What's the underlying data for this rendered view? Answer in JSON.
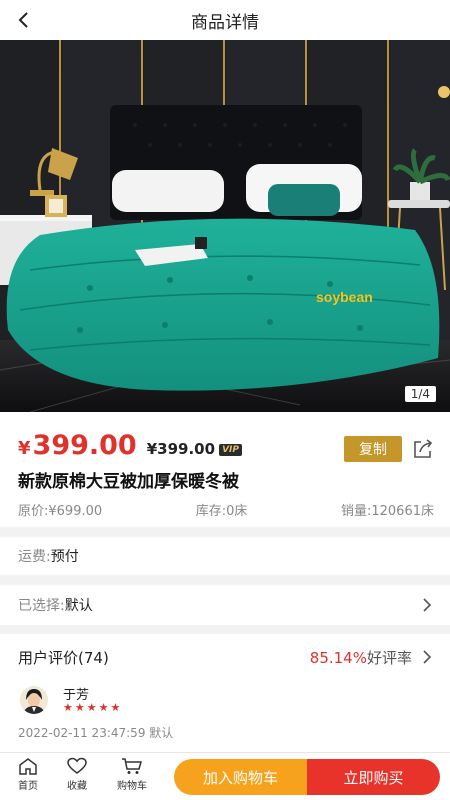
{
  "header": {
    "title": "商品详情"
  },
  "gallery": {
    "page_indicator": "1/4"
  },
  "price": {
    "currency": "¥",
    "main": "399.00",
    "vip_price": "¥399.00",
    "vip_badge": "VIP",
    "copy_label": "复制"
  },
  "product": {
    "name": "新款原棉大豆被加厚保暖冬被",
    "original_price": "原价:¥699.00",
    "stock": "库存:0床",
    "sales": "销量:120661床"
  },
  "shipping": {
    "label": "运费:",
    "value": "预付"
  },
  "selection": {
    "label": "已选择:",
    "value": "默认"
  },
  "reviews": {
    "title": "用户评价(74)",
    "rate": "85.14%",
    "rate_label": "好评率",
    "items": [
      {
        "name": "于芳",
        "stars": "★★★★★",
        "meta": "2022-02-11 23:47:59 默认"
      }
    ]
  },
  "bottom_bar": {
    "home": "首页",
    "favorite": "收藏",
    "cart": "购物车",
    "add_to_cart": "加入购物车",
    "buy_now": "立即购买"
  },
  "colors": {
    "price_red": "#e0312b",
    "copy_gold": "#c5962a",
    "cart_orange": "#f7a21c",
    "buy_red": "#e8332b"
  }
}
